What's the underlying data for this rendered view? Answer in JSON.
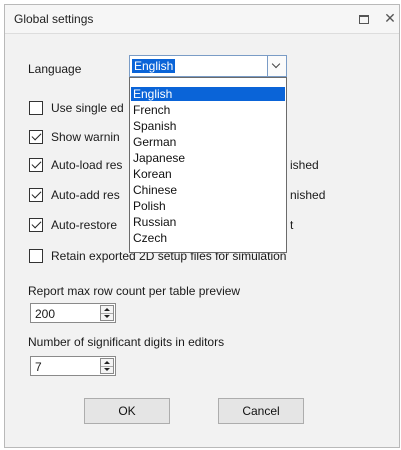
{
  "dialog": {
    "title": "Global settings",
    "maximize_icon": "maximize-icon",
    "close_icon": "close-icon"
  },
  "language": {
    "label": "Language",
    "selected": "English",
    "options": [
      "English",
      "French",
      "Spanish",
      "German",
      "Japanese",
      "Korean",
      "Chinese",
      "Polish",
      "Russian",
      "Czech"
    ]
  },
  "checkboxes": [
    {
      "label": "Use single ed",
      "checked": false
    },
    {
      "label": "Show warnin",
      "checked": true
    },
    {
      "label": "Auto-load res",
      "checked": true,
      "trailing": "ished"
    },
    {
      "label": "Auto-add res",
      "checked": true,
      "trailing": "nished"
    },
    {
      "label": "Auto-restore",
      "checked": true,
      "trailing": "t"
    },
    {
      "label": "Retain exported 2D setup files for simulation",
      "checked": false
    }
  ],
  "report_rows": {
    "label": "Report max row count per table preview",
    "value": "200"
  },
  "sig_digits": {
    "label": "Number of significant digits in editors",
    "value": "7"
  },
  "buttons": {
    "ok": "OK",
    "cancel": "Cancel"
  },
  "colors": {
    "selection": "#0a64d8",
    "dialog_bg": "#f2f2f2"
  }
}
